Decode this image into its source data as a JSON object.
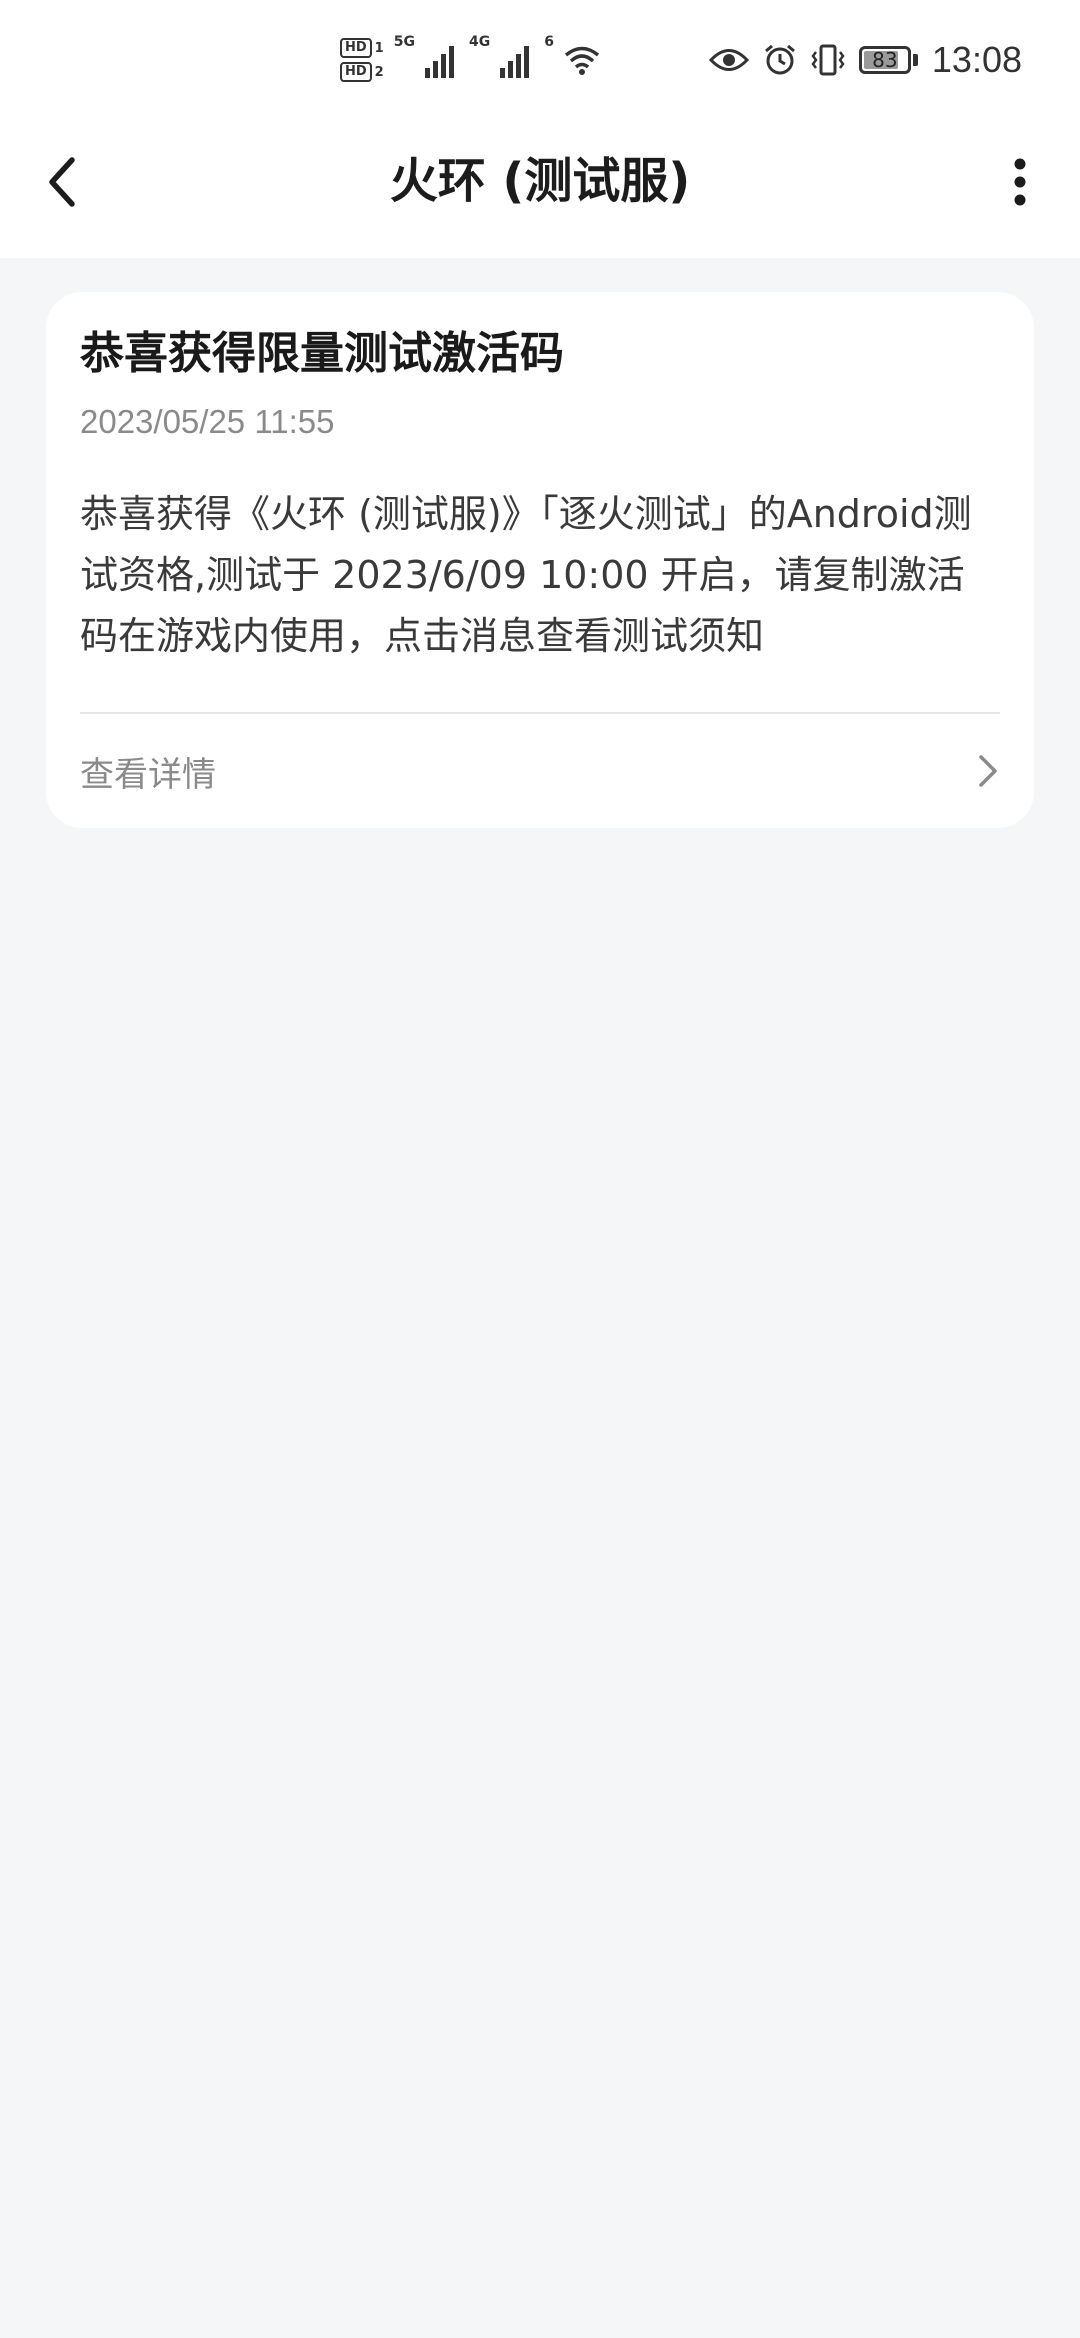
{
  "status_bar": {
    "hd1": "HD",
    "hd1_sub": "1",
    "hd2": "HD",
    "hd2_sub": "2",
    "net1": "5G",
    "net2": "4G",
    "wifi_badge": "6",
    "battery_level": "83",
    "time": "13:08",
    "icons": [
      "eye-icon",
      "alarm-icon",
      "vibrate-icon",
      "battery-icon"
    ]
  },
  "app_bar": {
    "title": "火环 (测试服)",
    "back_icon": "chevron-left-icon",
    "more_icon": "more-vertical-icon"
  },
  "message": {
    "title": "恭喜获得限量测试激活码",
    "time": "2023/05/25 11:55",
    "body": "恭喜获得《火环 (测试服)》「逐火测试」的Android测试资格,测试于 2023/6/09 10:00 开启，请复制激活码在游戏内使用，点击消息查看测试须知",
    "detail_label": "查看详情",
    "detail_icon": "chevron-right-icon"
  },
  "colors": {
    "background": "#f5f6f8",
    "card": "#ffffff",
    "title_text": "#1a1a1a",
    "secondary_text": "#8a8a8a"
  }
}
